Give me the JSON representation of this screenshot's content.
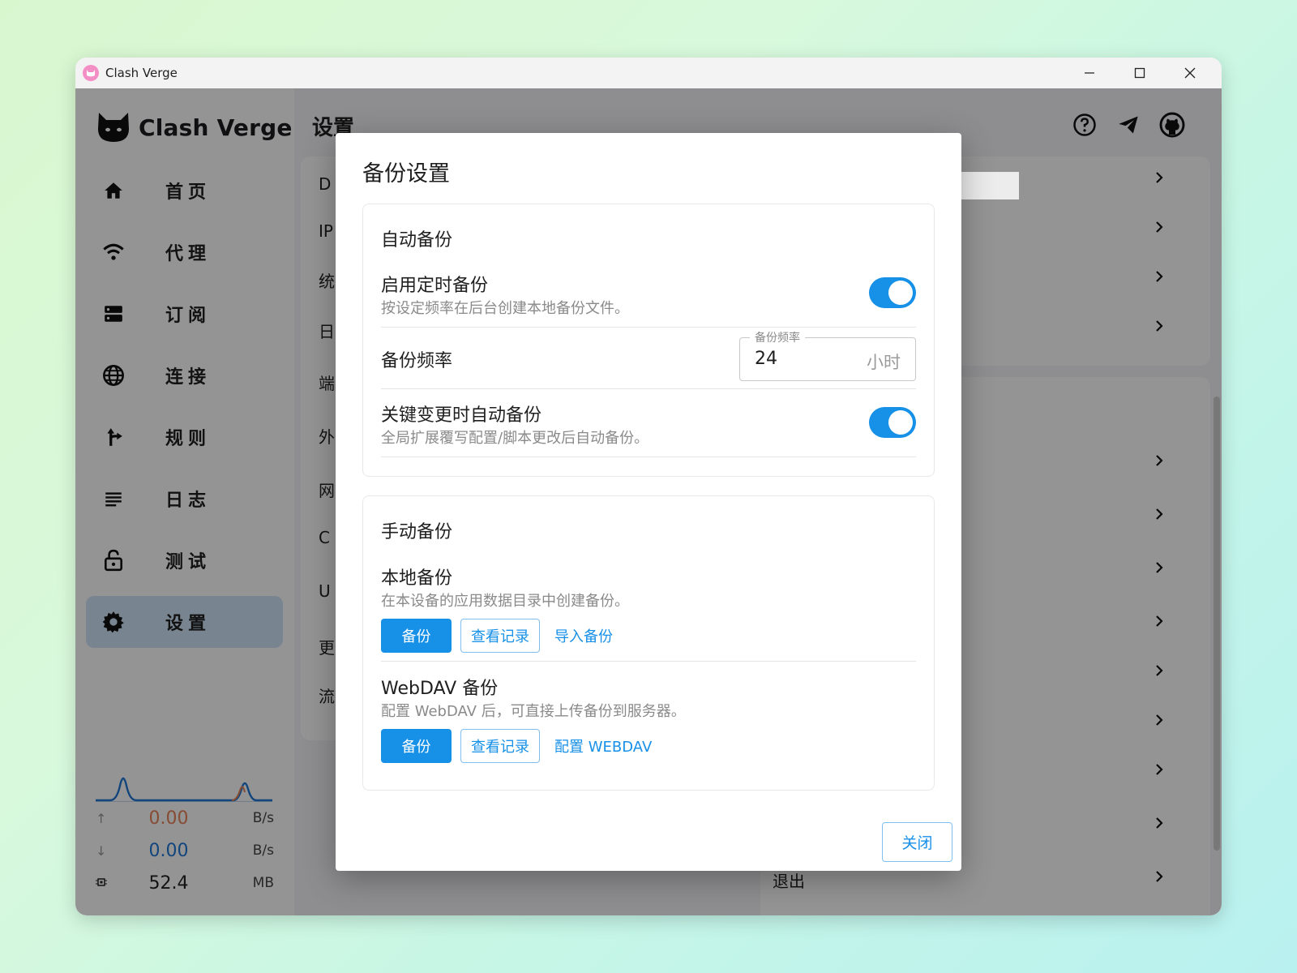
{
  "window": {
    "title": "Clash Verge"
  },
  "sidebar": {
    "logo_text": "Clash Verge",
    "items": [
      {
        "label": "首页",
        "icon": "home-icon"
      },
      {
        "label": "代理",
        "icon": "wifi-icon"
      },
      {
        "label": "订阅",
        "icon": "storage-icon"
      },
      {
        "label": "连接",
        "icon": "globe-icon"
      },
      {
        "label": "规则",
        "icon": "fork-arrow-icon"
      },
      {
        "label": "日志",
        "icon": "list-icon"
      },
      {
        "label": "测试",
        "icon": "lock-icon"
      },
      {
        "label": "设置",
        "icon": "gear-icon",
        "active": true
      }
    ],
    "traffic": {
      "upload_value": "0.00",
      "upload_unit": "B/s",
      "download_value": "0.00",
      "download_unit": "B/s",
      "memory_value": "52.4",
      "memory_unit": "MB"
    }
  },
  "main": {
    "title": "设置",
    "left_rows": [
      "D",
      "IP",
      "统",
      "日",
      "端",
      "外",
      "网",
      "C",
      "U",
      "更",
      "流"
    ],
    "exit_label": "退出"
  },
  "dialog": {
    "title": "备份设置",
    "auto_section": {
      "title": "自动备份",
      "scheduled": {
        "title": "启用定时备份",
        "desc": "按设定频率在后台创建本地备份文件。",
        "enabled": true
      },
      "frequency": {
        "title": "备份频率",
        "legend": "备份频率",
        "value": "24",
        "unit": "小时"
      },
      "on_change": {
        "title": "关键变更时自动备份",
        "desc": "全局扩展覆写配置/脚本更改后自动备份。",
        "enabled": true
      }
    },
    "manual_section": {
      "title": "手动备份",
      "local": {
        "title": "本地备份",
        "desc": "在本设备的应用数据目录中创建备份。",
        "backup_label": "备份",
        "history_label": "查看记录",
        "import_label": "导入备份"
      },
      "webdav": {
        "title": "WebDAV 备份",
        "desc": "配置 WebDAV 后，可直接上传备份到服务器。",
        "backup_label": "备份",
        "history_label": "查看记录",
        "config_label": "配置 WEBDAV"
      }
    },
    "close_label": "关闭"
  },
  "colors": {
    "accent": "#1790e8",
    "upload": "#e8845a",
    "download": "#1f77d6"
  }
}
